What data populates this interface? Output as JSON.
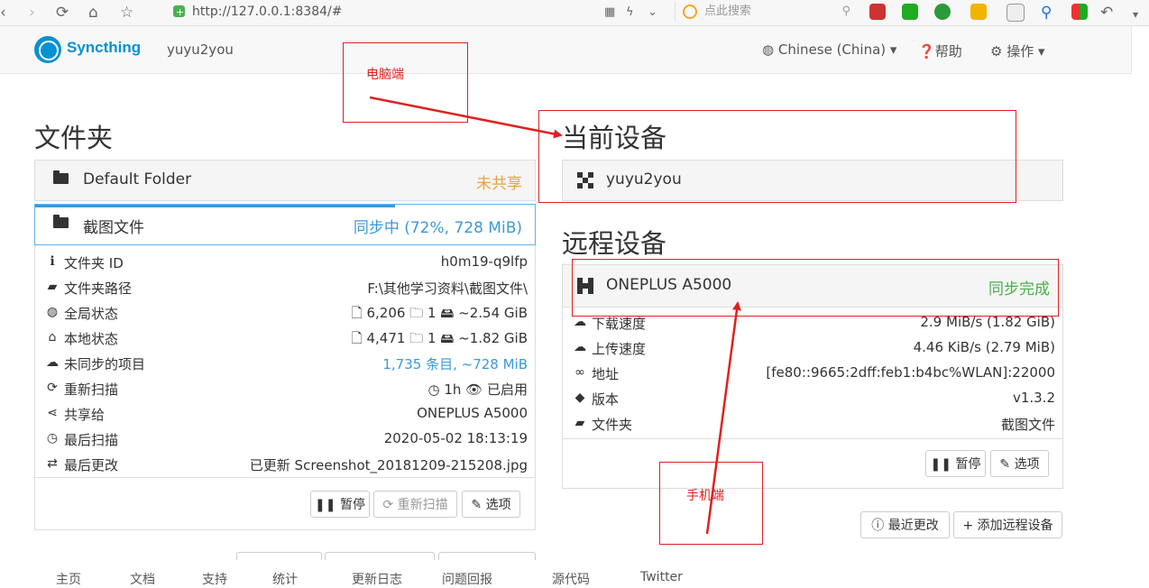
{
  "browser": {
    "url": "http://127.0.0.1:8384/#",
    "search_placeholder": "点此搜索"
  },
  "navbar": {
    "brand": "Syncthing",
    "device_name": "yuyu2you",
    "language": "Chinese (China) ▾",
    "help": "帮助",
    "actions": "操作 ▾"
  },
  "folders": {
    "heading": "文件夹",
    "default_folder": {
      "name": "Default Folder",
      "status": "未共享"
    },
    "screenshot_folder": {
      "name": "截图文件",
      "status": "同步中 (72%, 728 MiB)",
      "progress": 0.72,
      "rows": [
        {
          "icon": "info-icon",
          "glyph": "ℹ",
          "label": "文件夹 ID",
          "value": "h0m19-q9lfp"
        },
        {
          "icon": "folder-open-icon",
          "glyph": "▰",
          "label": "文件夹路径",
          "value": "F:\\其他学习资料\\截图文件\\"
        },
        {
          "icon": "globe-icon",
          "glyph": "◍",
          "label": "全局状态",
          "value": "🗋 6,206   🗀 1   🖴 ~2.54 GiB"
        },
        {
          "icon": "home-icon",
          "glyph": "⌂",
          "label": "本地状态",
          "value": "🗋 4,471   🗀 1   🖴 ~1.82 GiB"
        },
        {
          "icon": "cloud-download-icon",
          "glyph": "☁",
          "label": "未同步的项目",
          "value": "1,735 条目, ~728 MiB"
        },
        {
          "icon": "refresh-icon",
          "glyph": "⟳",
          "label": "重新扫描",
          "value": "◷ 1h   👁 已启用"
        },
        {
          "icon": "share-icon",
          "glyph": "⋖",
          "label": "共享给",
          "value": "ONEPLUS A5000"
        },
        {
          "icon": "clock-icon",
          "glyph": "◷",
          "label": "最后扫描",
          "value": "2020-05-02 18:13:19"
        },
        {
          "icon": "exchange-icon",
          "glyph": "⇄",
          "label": "最后更改",
          "value": "已更新 Screenshot_20181209-215208.jpg"
        }
      ],
      "buttons": {
        "pause": "❚❚ 暂停",
        "rescan": "⟳ 重新扫描",
        "options": "✎ 选项"
      }
    }
  },
  "this_device": {
    "heading": "当前设备",
    "name": "yuyu2you"
  },
  "remote_devices": {
    "heading": "远程设备",
    "device": {
      "name": "ONEPLUS A5000",
      "status": "同步完成",
      "rows": [
        {
          "icon": "cloud-download-icon",
          "glyph": "☁",
          "label": "下载速度",
          "value": "2.9 MiB/s (1.82 GiB)"
        },
        {
          "icon": "cloud-upload-icon",
          "glyph": "☁",
          "label": "上传速度",
          "value": "4.46 KiB/s (2.79 MiB)"
        },
        {
          "icon": "link-icon",
          "glyph": "∞",
          "label": "地址",
          "value": "[fe80::9665:2dff:feb1:b4bc%WLAN]:22000"
        },
        {
          "icon": "tag-icon",
          "glyph": "◆",
          "label": "版本",
          "value": "v1.3.2"
        },
        {
          "icon": "folder-icon",
          "glyph": "▰",
          "label": "文件夹",
          "value": "截图文件"
        }
      ],
      "buttons": {
        "pause": "❚❚ 暂停",
        "options": "✎ 选项"
      }
    },
    "recent_changes": "ⓘ 最近更改",
    "add_device": "+ 添加远程设备"
  },
  "annotations": {
    "pc": "电脑端",
    "phone": "手机端"
  },
  "footer": {
    "items": [
      "主页",
      "文档",
      "支持",
      "统计",
      "更新日志",
      "问题回报",
      "源代码",
      "Twitter"
    ]
  },
  "colors": {
    "accent": "#0891d1",
    "syncing": "#3a9ad9",
    "unshared": "#e8a33d",
    "done": "#4cae4c",
    "annotation": "#e02020"
  }
}
